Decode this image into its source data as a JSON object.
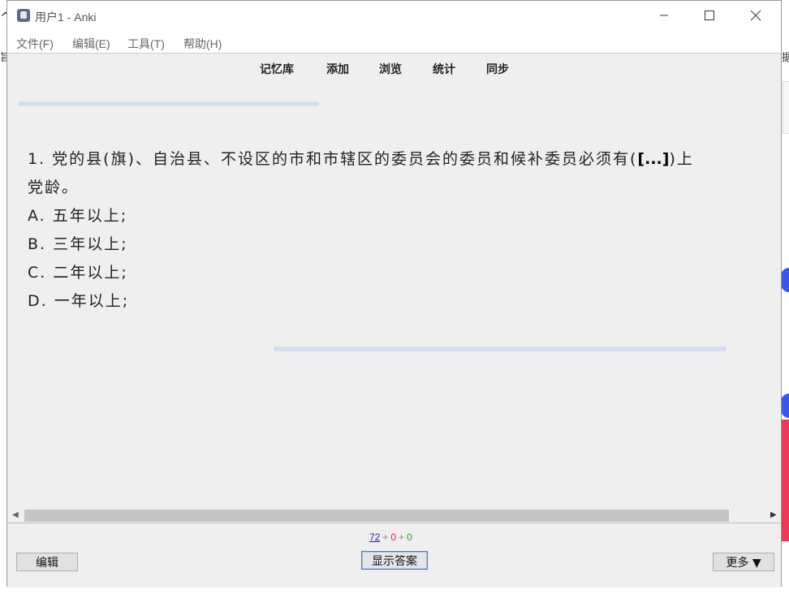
{
  "background": {
    "left_arrow": "^",
    "left_glyph": "旨",
    "right_glyph": "据"
  },
  "window": {
    "title": "用户1 - Anki",
    "controls": {
      "minimize": "—",
      "maximize": "☐",
      "close": "✕"
    }
  },
  "menu": {
    "items": [
      {
        "label": "文件(F)"
      },
      {
        "label": "编辑(E)"
      },
      {
        "label": "工具(T)"
      },
      {
        "label": "帮助(H)"
      }
    ]
  },
  "toolbar": {
    "links": [
      {
        "label": "记忆库"
      },
      {
        "label": "添加"
      },
      {
        "label": "浏览"
      },
      {
        "label": "统计"
      },
      {
        "label": "同步"
      }
    ]
  },
  "card": {
    "question_part1": "1. 党的县(旗)、自治县、不设区的市和市辖区的委员会的委员和候补委员必须有(",
    "cloze": "[...]",
    "question_part2": ")上",
    "question_line2": "党龄。",
    "options": [
      {
        "text": "A. 五年以上;"
      },
      {
        "text": "B. 三年以上;"
      },
      {
        "text": "C. 二年以上;"
      },
      {
        "text": "D. 一年以上;"
      }
    ]
  },
  "scrollbar": {
    "left_arrow": "◀",
    "right_arrow": "▶"
  },
  "bottom": {
    "count_new": "72",
    "plus": "+",
    "count_learn": "0",
    "count_review": "0",
    "edit_button": "编辑",
    "show_answer_button": "显示答案",
    "more_button": "更多 ▼"
  },
  "colors": {
    "new": "#1f1fd0",
    "learn": "#c0392b",
    "review": "#2a9d2a"
  }
}
